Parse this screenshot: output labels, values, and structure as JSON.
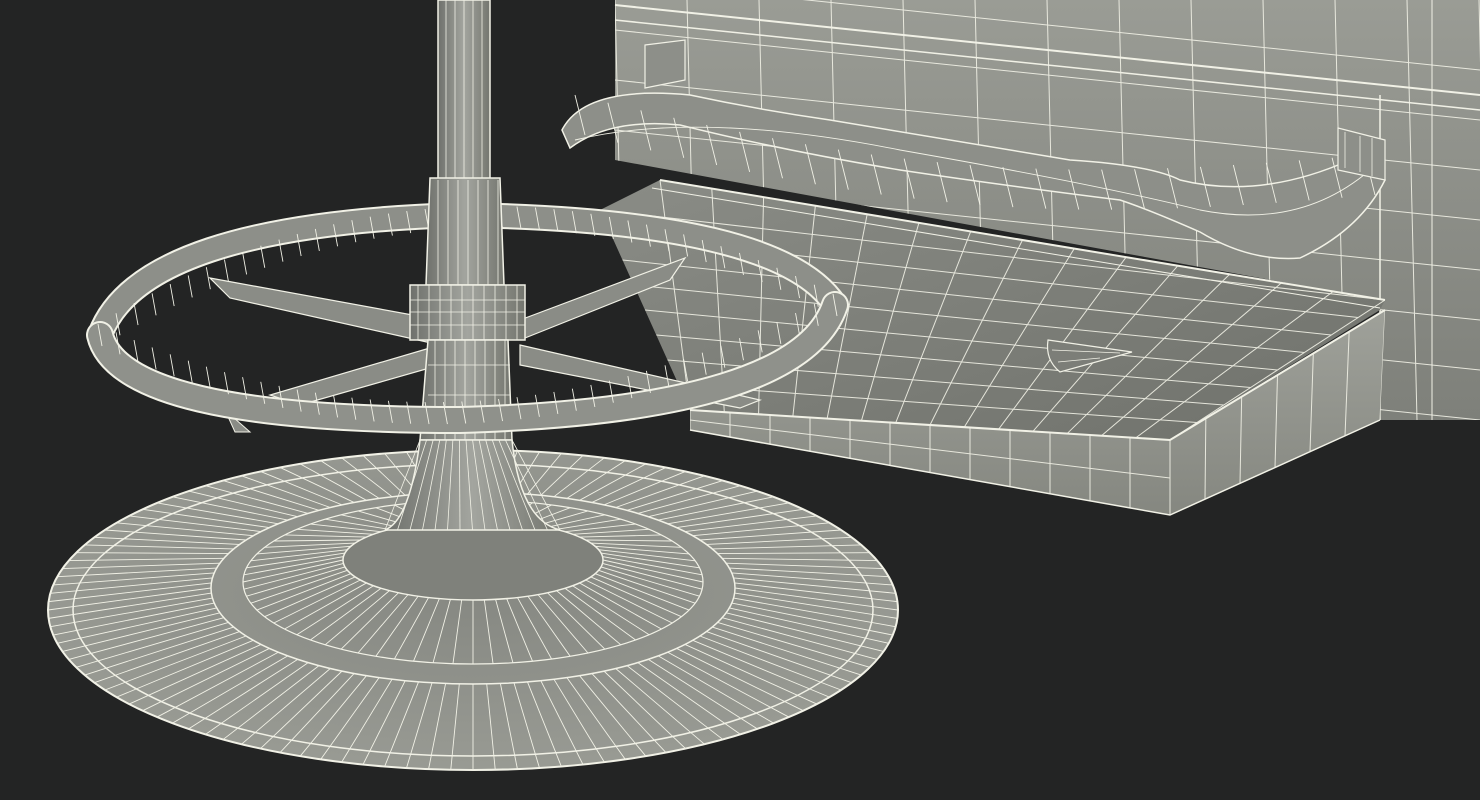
{
  "scene": {
    "background_color": "#232424",
    "surface_color": "#8f918b",
    "surface_light": "#a3a59e",
    "surface_dark": "#6b6d68",
    "wire_color": "#f1f1e6",
    "objects": [
      "wireframe-floor-stand",
      "footrest-ring",
      "pedestal-post",
      "chair-seat-platform",
      "chair-backrest",
      "armrest-bar",
      "round-base"
    ]
  }
}
